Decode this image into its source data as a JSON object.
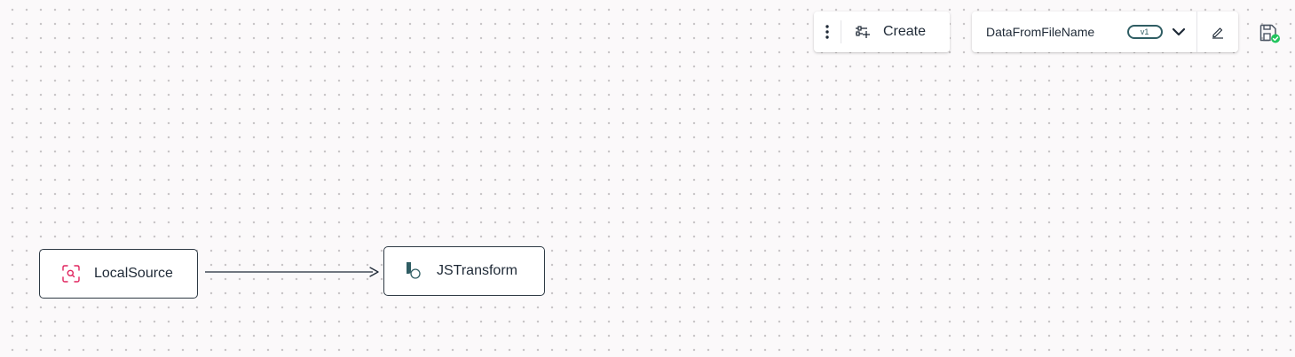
{
  "toolbar": {
    "more_icon": "kebab-vertical-icon",
    "create_icon": "sliders-add-icon",
    "create_label": "Create"
  },
  "flow": {
    "name": "DataFromFileName",
    "version": "v1",
    "dropdown_icon": "chevron-down-icon",
    "edit_icon": "pencil-icon"
  },
  "save_status": {
    "icon": "floppy-disk-saved-icon",
    "accent": "#22c55e"
  },
  "nodes": [
    {
      "label": "LocalSource",
      "icon": "scan-search-icon",
      "accent": "#e0245e"
    },
    {
      "label": "JSTransform",
      "icon": "js-transform-icon",
      "accent": "#2f5d63"
    }
  ],
  "edges": [
    {
      "from": "LocalSource",
      "to": "JSTransform"
    }
  ]
}
